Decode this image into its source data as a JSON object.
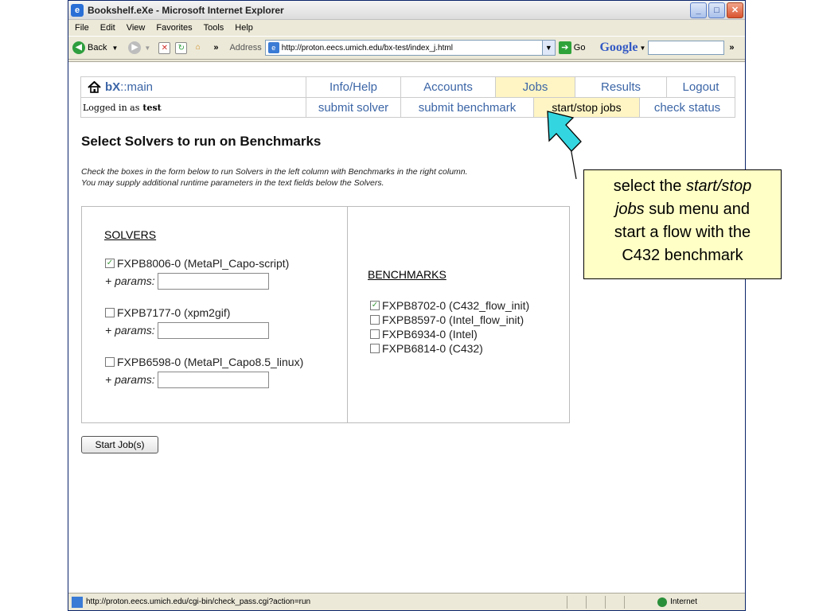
{
  "window": {
    "title": "Bookshelf.eXe - Microsoft Internet Explorer",
    "controls": {
      "minimize": "_",
      "maximize": "□",
      "close": "✕"
    }
  },
  "menu": {
    "items": [
      "File",
      "Edit",
      "View",
      "Favorites",
      "Tools",
      "Help"
    ]
  },
  "toolbar": {
    "back_label": "Back",
    "address_label": "Address",
    "url": "http://proton.eecs.umich.edu/bx-test/index_j.html",
    "go_label": "Go",
    "google_label": "Google",
    "more": "»"
  },
  "nav": {
    "brand_bold": "bX",
    "brand_rest": "::main",
    "top": [
      "Info/Help",
      "Accounts",
      "Jobs",
      "Results",
      "Logout"
    ],
    "logged_label": "Logged in as",
    "logged_user": "test",
    "sub": [
      "submit solver",
      "submit benchmark",
      "start/stop jobs",
      "check status"
    ]
  },
  "page": {
    "title": "Select Solvers to run on Benchmarks",
    "intro_1": "Check the boxes in the form below to run Solvers in the left column with Benchmarks in the right column.",
    "intro_2": "You may supply additional runtime parameters in the text fields below the Solvers."
  },
  "solvers": {
    "heading": "SOLVERS",
    "params_label": "+ params:",
    "items": [
      {
        "label": "FXPB8006-0 (MetaPl_Capo-script)",
        "checked": true
      },
      {
        "label": "FXPB7177-0 (xpm2gif)",
        "checked": false
      },
      {
        "label": "FXPB6598-0 (MetaPl_Capo8.5_linux)",
        "checked": false
      }
    ]
  },
  "benchmarks": {
    "heading": "BENCHMARKS",
    "items": [
      {
        "label": "FXPB8702-0 (C432_flow_init)",
        "checked": true
      },
      {
        "label": "FXPB8597-0 (Intel_flow_init)",
        "checked": false
      },
      {
        "label": "FXPB6934-0 (Intel)",
        "checked": false
      },
      {
        "label": "FXPB6814-0 (C432)",
        "checked": false
      }
    ]
  },
  "actions": {
    "start_label": "Start Job(s)"
  },
  "callout": {
    "line1a": "select the ",
    "line1b": "start/stop",
    "line2a": "jobs",
    "line2b": " sub menu and",
    "line3": "start a flow with the",
    "line4": "C432 benchmark"
  },
  "status": {
    "url": "http://proton.eecs.umich.edu/cgi-bin/check_pass.cgi?action=run",
    "zone": "Internet"
  },
  "colors": {
    "nav_link": "#3b65a6",
    "active_tab": "#fff5c4",
    "callout_bg": "#ffffc6",
    "arrow": "#33d6e0"
  },
  "checkmark": "✓"
}
